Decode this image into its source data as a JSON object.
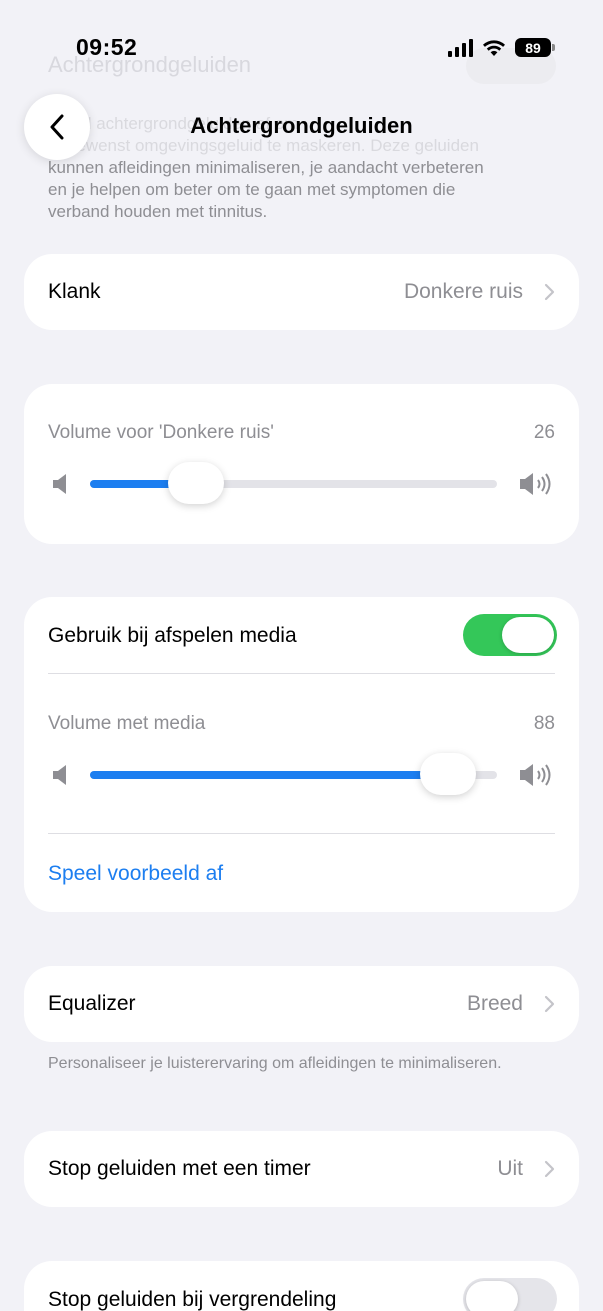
{
  "status": {
    "time": "09:52",
    "battery": "89"
  },
  "nav": {
    "title": "Achtergrondgeluiden"
  },
  "background": {
    "ghost_title": "Achtergrondgeluiden",
    "intro_lines": [
      "Speel achtergrondgeluiden af om",
      "ongewenst omgevingsgeluid te maskeren. Deze geluiden",
      "kunnen afleidingen minimaliseren, je aandacht verbeteren",
      "en je helpen om beter om te gaan met symptomen die",
      "verband houden met tinnitus."
    ]
  },
  "sound": {
    "label": "Klank",
    "value": "Donkere ruis"
  },
  "volume": {
    "label": "Volume voor 'Donkere ruis'",
    "value": "26",
    "level": 0.26
  },
  "media": {
    "toggle_label": "Gebruik bij afspelen media",
    "toggle_on": true,
    "volume_label": "Volume met media",
    "volume_value": "88",
    "level": 0.88,
    "preview_link": "Speel voorbeeld af"
  },
  "equalizer": {
    "label": "Equalizer",
    "value": "Breed",
    "footnote": "Personaliseer je luisterervaring om afleidingen te minimaliseren."
  },
  "timer": {
    "label": "Stop geluiden met een timer",
    "value": "Uit"
  },
  "lock": {
    "label": "Stop geluiden bij vergrendeling",
    "toggle_on": false
  },
  "colors": {
    "accent": "#1c7ef0",
    "toggle_on": "#34c759",
    "toggle_off": "#e5e5ea",
    "background": "#f2f2f7"
  }
}
